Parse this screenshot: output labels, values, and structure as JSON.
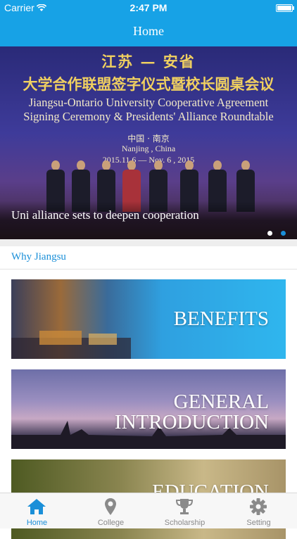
{
  "status_bar": {
    "carrier": "Carrier",
    "time": "2:47 PM"
  },
  "nav": {
    "title": "Home"
  },
  "carousel": {
    "banner_lines": {
      "cn_line1": "江苏 — 安省",
      "cn_line2": "大学合作联盟签字仪式暨校长圆桌会议",
      "en_line1": "Jiangsu-Ontario University Cooperative Agreement",
      "en_line2": "Signing Ceremony & Presidents' Alliance Roundtable",
      "cn_location": "中国 · 南京",
      "en_location": "Nanjing , China",
      "date": "2015.11.6 — Nov. 6 , 2015"
    },
    "caption": "Uni alliance sets to deepen cooperation",
    "page_count": 2,
    "active_page": 1
  },
  "section": {
    "label": "Why Jiangsu"
  },
  "cards": [
    {
      "title": "BENEFITS"
    },
    {
      "title_line1": "GENERAL",
      "title_line2": "INTRODUCTION"
    },
    {
      "title": "EDUCATION"
    }
  ],
  "tabs": [
    {
      "label": "Home",
      "icon": "home-icon",
      "active": true
    },
    {
      "label": "College",
      "icon": "location-pin-icon",
      "active": false
    },
    {
      "label": "Scholarship",
      "icon": "trophy-icon",
      "active": false
    },
    {
      "label": "Setting",
      "icon": "gear-icon",
      "active": false
    }
  ],
  "colors": {
    "accent": "#17a2e6",
    "active_tab": "#1a8fd8",
    "inactive_tab": "#8a8a8a"
  }
}
